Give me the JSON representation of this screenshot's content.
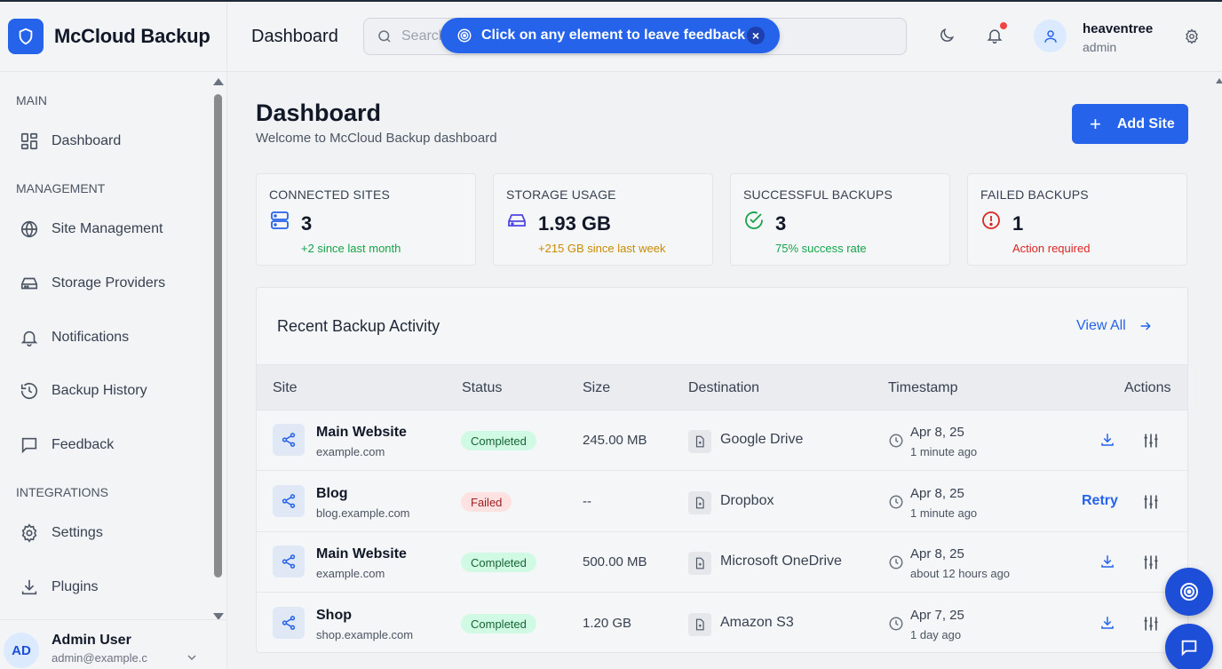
{
  "app": {
    "name": "McCloud Backup"
  },
  "sidebar": {
    "sections": {
      "main": "MAIN",
      "management": "MANAGEMENT",
      "integrations": "INTEGRATIONS"
    },
    "items": [
      {
        "label": "Dashboard",
        "icon": "dashboard-icon"
      },
      {
        "label": "Site Management",
        "icon": "globe-icon"
      },
      {
        "label": "Storage Providers",
        "icon": "hard-drive-icon"
      },
      {
        "label": "Notifications",
        "icon": "bell-icon"
      },
      {
        "label": "Backup History",
        "icon": "history-icon"
      },
      {
        "label": "Feedback",
        "icon": "message-icon"
      },
      {
        "label": "Settings",
        "icon": "gear-icon"
      },
      {
        "label": "Plugins",
        "icon": "download-icon"
      }
    ],
    "user": {
      "initials": "AD",
      "name": "Admin User",
      "email": "admin@example.c"
    }
  },
  "header": {
    "title": "Dashboard",
    "search_placeholder": "Search...",
    "user": {
      "name": "heaventree",
      "role": "admin"
    }
  },
  "feedback_banner": {
    "text": "Click on any element to leave feedback",
    "close": "×"
  },
  "page": {
    "title": "Dashboard",
    "subtitle": "Welcome to McCloud Backup dashboard",
    "add_site_label": "Add Site"
  },
  "stats": [
    {
      "label": "CONNECTED SITES",
      "value": "3",
      "note": "+2 since last month",
      "color": "#16a34a",
      "icon": "server-icon"
    },
    {
      "label": "STORAGE USAGE",
      "value": "1.93 GB",
      "note": "+215 GB since last week",
      "color": "#ca8a04",
      "icon": "hard-drive-icon"
    },
    {
      "label": "SUCCESSFUL BACKUPS",
      "value": "3",
      "note": "75% success rate",
      "color": "#16a34a",
      "icon": "check-circle-icon"
    },
    {
      "label": "FAILED BACKUPS",
      "value": "1",
      "note": "Action required",
      "color": "#dc2626",
      "icon": "alert-circle-icon"
    }
  ],
  "activity": {
    "title": "Recent Backup Activity",
    "view_all": "View All",
    "columns": [
      "Site",
      "Status",
      "Size",
      "Destination",
      "Timestamp",
      "Actions"
    ],
    "rows": [
      {
        "site": "Main Website",
        "url": "example.com",
        "status": "Completed",
        "size": "245.00 MB",
        "destination": "Google Drive",
        "date": "Apr 8, 25",
        "relative": "1 minute ago"
      },
      {
        "site": "Blog",
        "url": "blog.example.com",
        "status": "Failed",
        "size": "--",
        "destination": "Dropbox",
        "date": "Apr 8, 25",
        "relative": "1 minute ago",
        "action": "Retry"
      },
      {
        "site": "Main Website",
        "url": "example.com",
        "status": "Completed",
        "size": "500.00 MB",
        "destination": "Microsoft OneDrive",
        "date": "Apr 8, 25",
        "relative": "about 12 hours ago"
      },
      {
        "site": "Shop",
        "url": "shop.example.com",
        "status": "Completed",
        "size": "1.20 GB",
        "destination": "Amazon S3",
        "date": "Apr 7, 25",
        "relative": "1 day ago"
      }
    ]
  },
  "colors": {
    "accent": "#2563eb",
    "success": "#16a34a",
    "warning": "#ca8a04",
    "danger": "#dc2626"
  }
}
